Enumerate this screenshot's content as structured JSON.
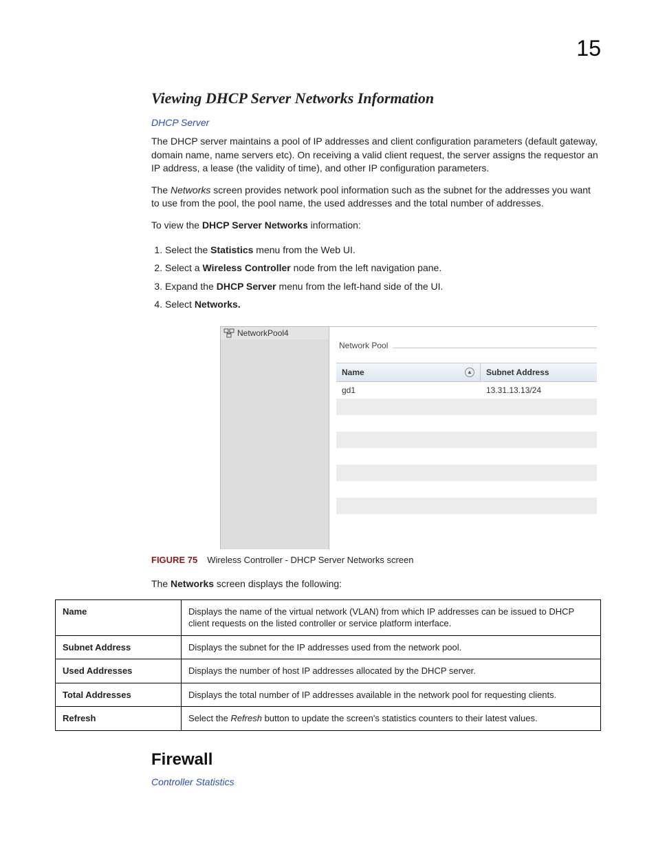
{
  "page_number": "15",
  "section_title": "Viewing DHCP Server Networks Information",
  "breadcrumb_link": "DHCP Server",
  "para1_a": "The DHCP server maintains a pool of IP addresses and client configuration parameters (default gateway, domain name, name servers etc). On receiving a valid client request, the server assigns the requestor an IP address, a lease (the validity of time), and other IP configuration parameters.",
  "para2_pre": "The ",
  "para2_em": "Networks",
  "para2_post": " screen provides network pool information such as the subnet for the addresses you want to use from the pool, the pool name, the used addresses and the total number of addresses.",
  "para3_pre": "To view the ",
  "para3_b": "DHCP Server Networks",
  "para3_post": " information:",
  "steps": [
    {
      "pre": "Select the ",
      "b": "Statistics",
      "post": " menu from the Web UI."
    },
    {
      "pre": "Select a ",
      "b": "Wireless Controller",
      "post": " node from the left navigation pane."
    },
    {
      "pre": "Expand the ",
      "b": "DHCP Server",
      "post": " menu from the left-hand side of the UI."
    },
    {
      "pre": "Select ",
      "b": "Networks.",
      "post": ""
    }
  ],
  "mock": {
    "tree_item": "NetworkPool4",
    "fieldset": "Network Pool",
    "col_name": "Name",
    "col_subnet": "Subnet Address",
    "rows": [
      {
        "name": "gd1",
        "subnet": "13.31.13.13/24"
      },
      {
        "name": "",
        "subnet": ""
      },
      {
        "name": "",
        "subnet": ""
      },
      {
        "name": "",
        "subnet": ""
      },
      {
        "name": "",
        "subnet": ""
      },
      {
        "name": "",
        "subnet": ""
      },
      {
        "name": "",
        "subnet": ""
      },
      {
        "name": "",
        "subnet": ""
      },
      {
        "name": "",
        "subnet": ""
      }
    ]
  },
  "figure_num": "FIGURE 75",
  "figure_caption": "Wireless Controller - DHCP Server Networks screen",
  "para4_pre": "The ",
  "para4_b": "Networks",
  "para4_post": " screen displays the following:",
  "def_table": [
    {
      "term": "Name",
      "desc": "Displays the name of the virtual network (VLAN) from which IP addresses can be issued to DHCP client requests on the listed controller or service platform interface."
    },
    {
      "term": "Subnet Address",
      "desc": "Displays the subnet for the IP addresses used from the network pool."
    },
    {
      "term": "Used Addresses",
      "desc": "Displays the number of host IP addresses allocated by the DHCP server."
    },
    {
      "term": "Total Addresses",
      "desc": "Displays the total number of IP addresses available in the network pool for requesting clients."
    },
    {
      "term": "Refresh",
      "desc_pre": "Select the ",
      "desc_em": "Refresh",
      "desc_post": " button to update the screen's statistics counters to their latest values."
    }
  ],
  "h2": "Firewall",
  "link2": "Controller Statistics"
}
